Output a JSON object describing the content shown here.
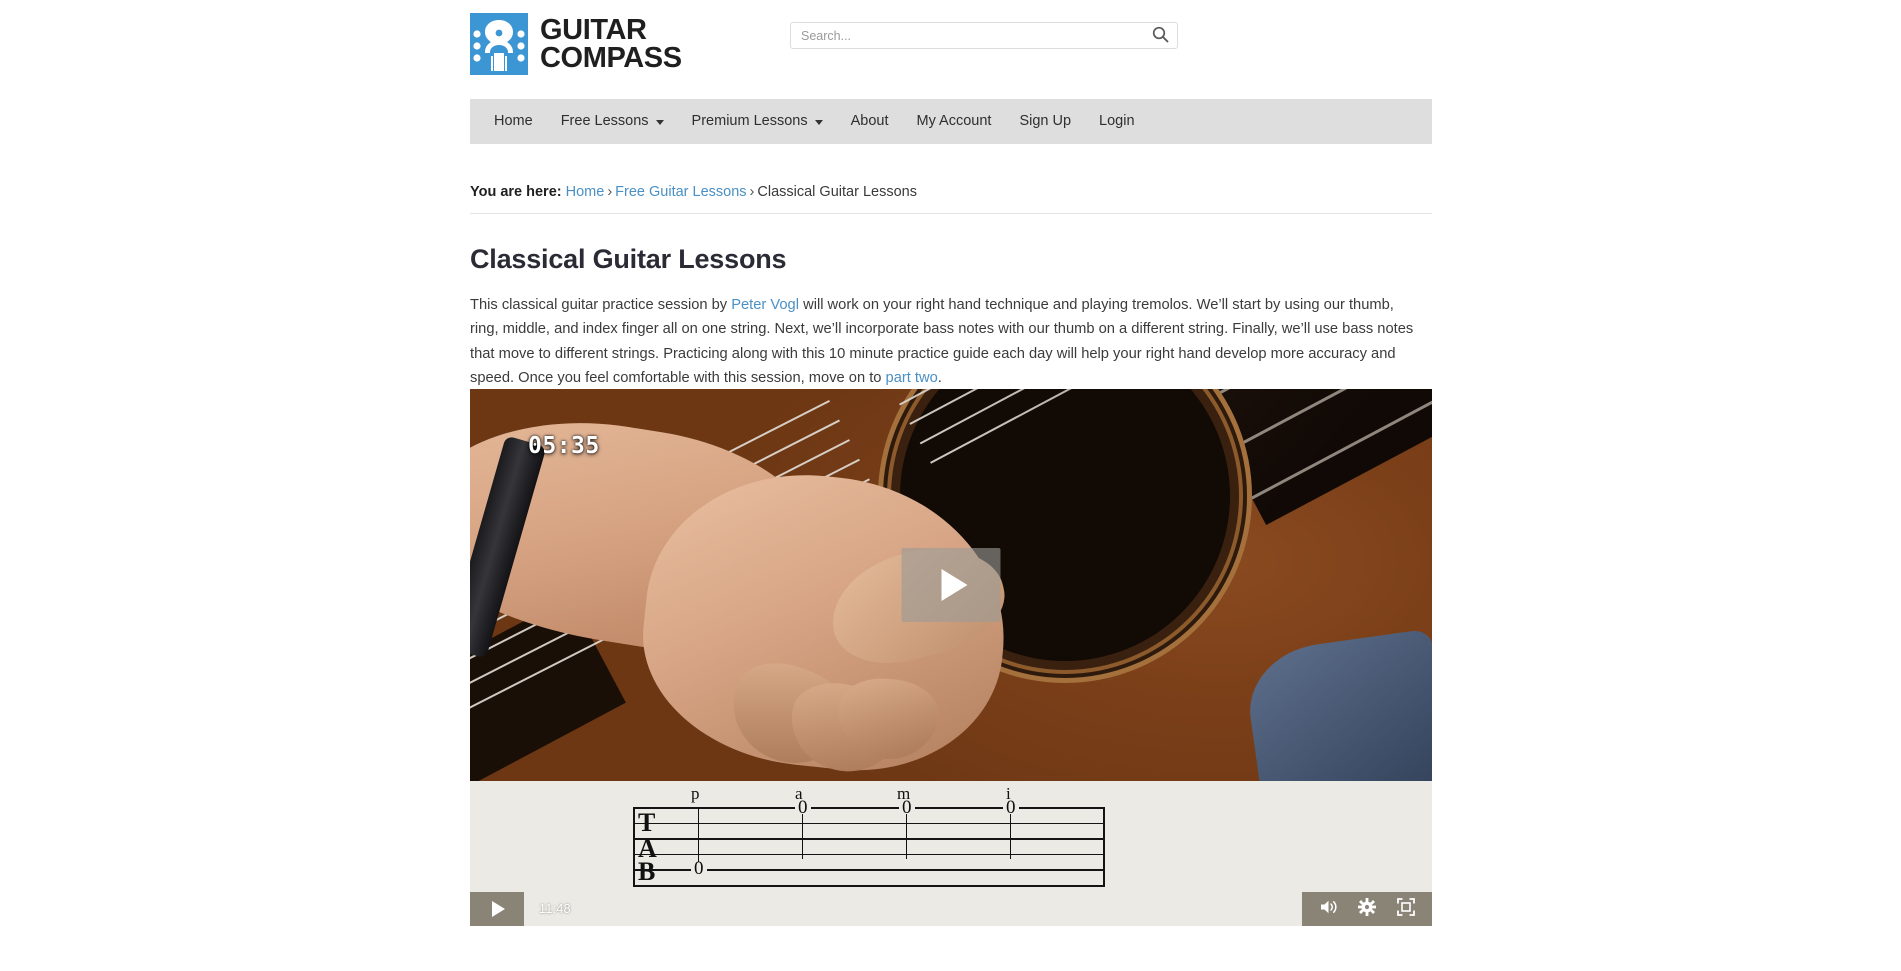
{
  "site": {
    "logo_text": "GUITAR\nCOMPASS",
    "logo_icon": "guitar-headstock-compass-logo",
    "brand_blue": "#3d96d4"
  },
  "search": {
    "placeholder": "Search...",
    "value": "",
    "icon": "search-icon"
  },
  "nav": {
    "items": [
      {
        "label": "Home",
        "has_dropdown": false
      },
      {
        "label": "Free Lessons",
        "has_dropdown": true
      },
      {
        "label": "Premium Lessons",
        "has_dropdown": true
      },
      {
        "label": "About",
        "has_dropdown": false
      },
      {
        "label": "My Account",
        "has_dropdown": false
      },
      {
        "label": "Sign Up",
        "has_dropdown": false
      },
      {
        "label": "Login",
        "has_dropdown": false
      }
    ]
  },
  "breadcrumb": {
    "prefix": "You are here:",
    "home": "Home",
    "sep": "›",
    "parent": "Free Guitar Lessons",
    "current": "Classical Guitar Lessons"
  },
  "main": {
    "title": "Classical Guitar Lessons",
    "intro_part_1": "This classical guitar practice session by ",
    "intro_link_1": "Peter Vogl",
    "intro_part_2": " will work on your right hand technique and playing tremolos. We’ll start by using our thumb, ring, middle, and index finger all on one string. Next, we’ll incorporate bass notes with our thumb on a different string. Finally, we’ll use bass notes that move to different strings. Practicing along with this 10 minute practice guide each day will help your right hand develop more accuracy and speed. Once you feel comfortable with this session, move on to ",
    "intro_link_2": "part two",
    "intro_part_3": "."
  },
  "video": {
    "overlay_timer": "05:35",
    "play_overlay_icon": "play-icon",
    "controls": {
      "play_icon": "play-icon",
      "time": "11:48",
      "volume_icon": "volume-icon",
      "settings_icon": "gear-icon",
      "fullscreen_icon": "fullscreen-icon"
    },
    "tab": {
      "staff_label_letters": [
        "T",
        "A",
        "B"
      ],
      "finger_labels": [
        "p",
        "a",
        "m",
        "i"
      ],
      "notes": [
        "0",
        "0",
        "0",
        "0"
      ]
    }
  }
}
